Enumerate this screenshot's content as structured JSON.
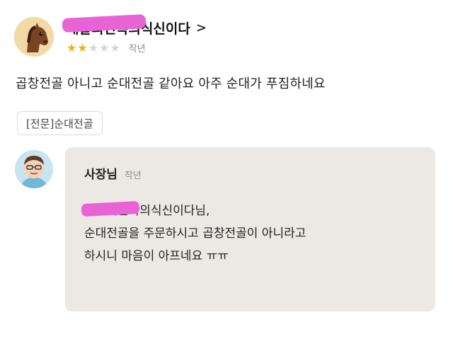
{
  "review": {
    "reviewer_name": "배달의민족의식신이다",
    "chevron": ">",
    "rating": 2,
    "rating_max": 5,
    "date": "작년",
    "text": "곱창전골 아니고 순대전골 같아요 아주 순대가 푸짐하네요",
    "menu_tag": "[전문]순대전골"
  },
  "reply": {
    "owner_name": "사장님",
    "date": "작년",
    "lines": [
      "배달의민족의식신이다님,",
      "순대전골을 주문하시고 곱창전골이 아니라고",
      "하시니 마음이 아프네요 ㅠㅠ"
    ]
  },
  "colors": {
    "star_on": "#f2b200",
    "star_off": "#d6d6d6",
    "redaction": "#e864d6",
    "reply_background": "#ece9e4"
  },
  "icons": {
    "reviewer_avatar": "horse-avatar-icon",
    "owner_avatar": "cartoon-person-avatar-icon"
  }
}
